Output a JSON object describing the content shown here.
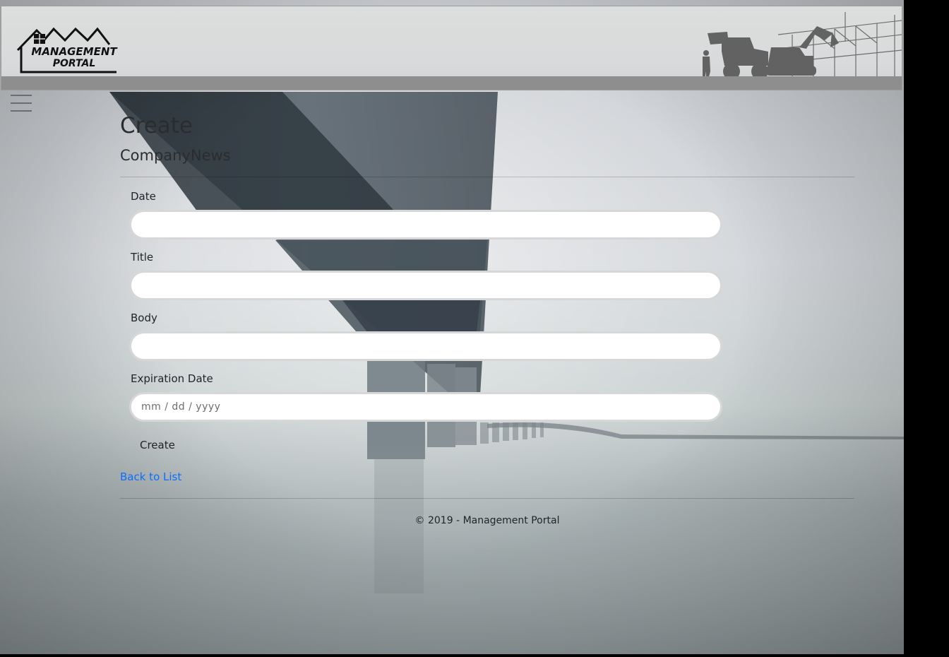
{
  "header": {
    "logo_line1": "MANAGEMENT",
    "logo_line2": "PORTAL"
  },
  "nav": {
    "menu_icon": "hamburger-menu-icon"
  },
  "page": {
    "title": "Create",
    "subtitle": "CompanyNews"
  },
  "form": {
    "fields": [
      {
        "label": "Date",
        "value": "",
        "placeholder": ""
      },
      {
        "label": "Title",
        "value": "",
        "placeholder": ""
      },
      {
        "label": "Body",
        "value": "",
        "placeholder": ""
      },
      {
        "label": "Expiration Date",
        "value": "",
        "placeholder": "mm / dd / yyyy"
      }
    ],
    "submit_label": "Create"
  },
  "links": {
    "back": "Back to List"
  },
  "footer": {
    "text": "© 2019 - Management Portal"
  },
  "colors": {
    "link": "#0d6efd",
    "header_bar": "#8e8e8e",
    "text": "#212529"
  }
}
